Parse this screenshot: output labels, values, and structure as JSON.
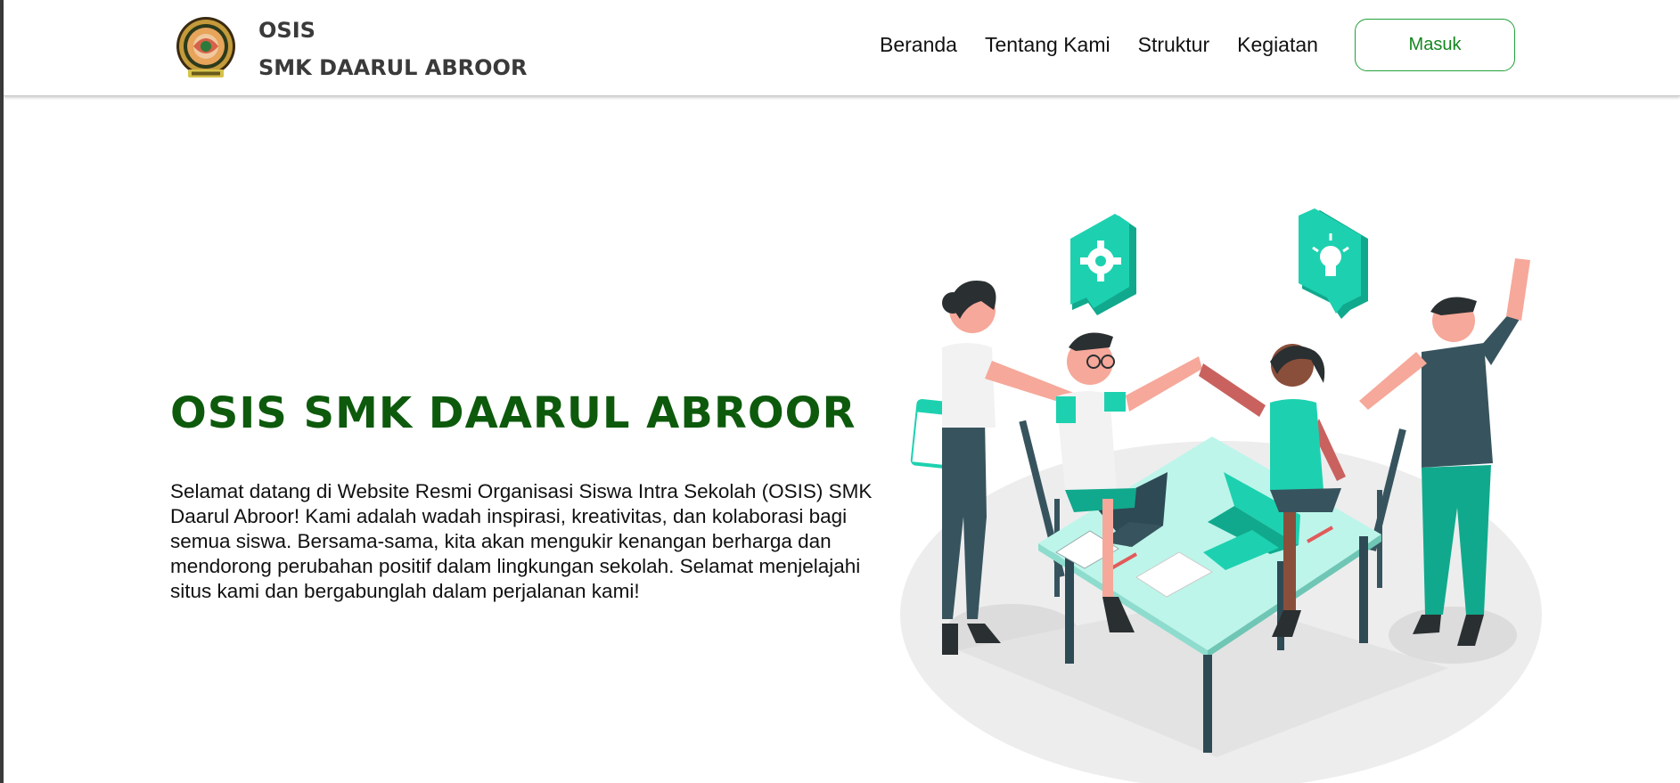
{
  "header": {
    "brand_line1": "OSIS",
    "brand_line2": "SMK DAARUL ABROOR",
    "logo_icon": "school-emblem-icon",
    "nav_links": [
      "Beranda",
      "Tentang Kami",
      "Struktur",
      "Kegiatan"
    ],
    "login_label": "Masuk"
  },
  "hero": {
    "title": "OSIS SMK DAARUL ABROOR",
    "description": "Selamat datang di Website Resmi Organisasi Siswa Intra Sekolah (OSIS) SMK Daarul Abroor! Kami adalah wadah inspirasi, kreativitas, dan kolaborasi bagi semua siswa. Bersama-sama, kita akan mengukir kenangan berharga dan mendorong perubahan positif dalam lingkungan sekolah. Selamat menjelajahi situs kami dan bergabunglah dalam perjalanan kami!",
    "illustration_icons": [
      "gear-icon",
      "lightbulb-icon",
      "team-illustration"
    ]
  },
  "colors": {
    "title_green": "#0d5a0d",
    "button_border": "#22a03a",
    "button_text": "#15861f",
    "accent_teal": "#1dd1b0",
    "dark_slate": "#37545e"
  }
}
